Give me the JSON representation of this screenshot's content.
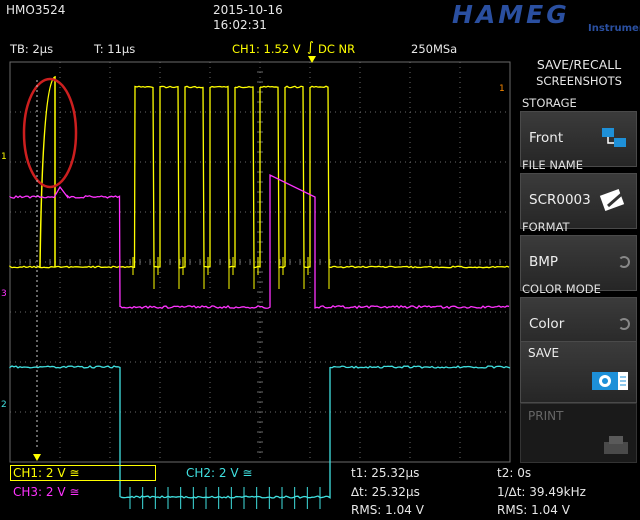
{
  "header": {
    "model": "HMO3524",
    "date": "2015-10-16",
    "time": "16:02:31",
    "logo": "HAMEG",
    "logo_sub": "Instruments",
    "tb": "TB: 2µs",
    "trig_time": "T: 11µs",
    "ch1_trigger": "CH1: 1.52 V",
    "trigger_mode": "DC NR",
    "sample_rate": "250MSa"
  },
  "menu": {
    "title": "SAVE/RECALL",
    "subtitle": "SCREENSHOTS",
    "storage_label": "STORAGE",
    "storage_value": "Front",
    "filename_label": "FILE NAME",
    "filename_value": "SCR0003",
    "format_label": "FORMAT",
    "format_value": "BMP",
    "colormode_label": "COLOR MODE",
    "colormode_value": "Color",
    "save_label": "SAVE",
    "print_label": "PRINT",
    "storage_icon": "folder-icon",
    "filename_icon": "edit-icon",
    "save_icon": "camera-icon",
    "print_icon": "printer-icon"
  },
  "channels": {
    "ch1": "CH1: 2 V",
    "ch2": "CH2: 2 V",
    "ch3": "CH3: 2 V",
    "coupling_symbol": "≅",
    "marker_1": "1",
    "marker_2": "2",
    "marker_3": "3",
    "marker_r": "1",
    "colors": {
      "ch1": "#ffff00",
      "ch2": "#40e0e0",
      "ch3": "#ff33ff",
      "grid": "#6a6a6a",
      "annotation": "#cc1f1f"
    }
  },
  "measurements": {
    "t1": "t1: 25.32µs",
    "t2": "t2: 0s",
    "dt": "∆t: 25.32µs",
    "inv_dt": "1/∆t: 39.49kHz",
    "rms1": "RMS: 1.04 V",
    "rms2": "RMS: 1.04 V"
  },
  "chart_data": {
    "type": "line",
    "description_units": "divisions",
    "x_divisions": 10,
    "y_divisions": 8,
    "series": [
      {
        "channel": "CH1",
        "levels_div": [
          -0.1,
          3.5
        ],
        "pulses_start_div": [
          2.5,
          3.0,
          3.5,
          4.0,
          4.5,
          5.0,
          5.5,
          6.0
        ],
        "pulse_width_div": 0.38
      },
      {
        "channel": "CH3",
        "levels_div": [
          1.3,
          -0.9
        ],
        "transitions_div": [
          2.2,
          5.2,
          6.1
        ]
      },
      {
        "channel": "CH2",
        "levels_div": [
          -2.1,
          -4.7
        ],
        "transitions_div": [
          2.2,
          6.4
        ]
      }
    ]
  }
}
